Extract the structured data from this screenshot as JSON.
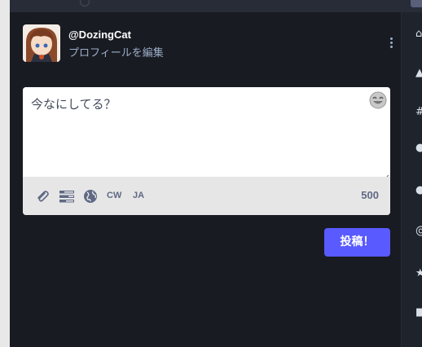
{
  "account": {
    "username": "@DozingCat",
    "edit_profile": "プロフィールを編集"
  },
  "compose": {
    "placeholder": "今なにしてる？",
    "cw_label": "CW",
    "language_label": "JA",
    "char_count": "500",
    "submit_label": "投稿！"
  },
  "icons": {
    "attach": "paperclip-icon",
    "poll": "poll-icon",
    "visibility": "globe-icon",
    "emoji": "emoji-icon",
    "menu": "kebab-menu-icon"
  },
  "colors": {
    "background": "#191b22",
    "accent": "#595aff",
    "secondary_text": "#9baec8",
    "toolbar_bg": "#e6e6e6",
    "toolbar_icon": "#606984"
  }
}
